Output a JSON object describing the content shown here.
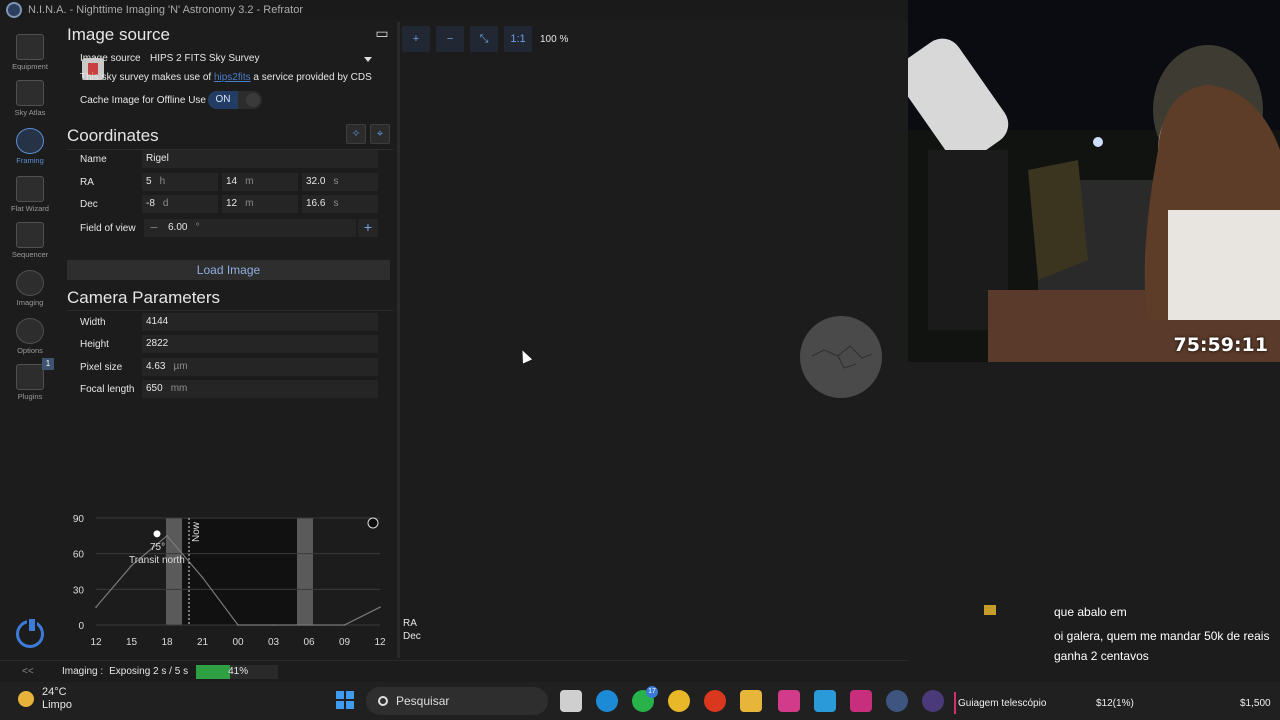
{
  "window": {
    "title": "N.I.N.A. - Nighttime Imaging 'N' Astronomy 3.2   -  Refrator"
  },
  "nav": {
    "items": [
      {
        "label": "Equipment"
      },
      {
        "label": "Sky Atlas"
      },
      {
        "label": "Framing"
      },
      {
        "label": "Flat Wizard"
      },
      {
        "label": "Sequencer"
      },
      {
        "label": "Imaging"
      },
      {
        "label": "Options"
      },
      {
        "label": "Plugins",
        "badge": "1"
      }
    ],
    "active": "Framing",
    "collapse": "<<"
  },
  "image_source": {
    "title": "Image source",
    "source_label": "Image source",
    "source_value": "HIPS 2 FITS Sky Survey",
    "note_prefix": "This sky survey makes use of ",
    "note_link": "hips2fits",
    "note_suffix": " a service provided by CDS",
    "cache_label": "Cache Image for Offline Use",
    "cache_toggle": "ON"
  },
  "coordinates": {
    "title": "Coordinates",
    "name_label": "Name",
    "name_value": "Rigel",
    "ra_label": "RA",
    "ra_h": "5",
    "ra_h_unit": "h",
    "ra_m": "14",
    "ra_m_unit": "m",
    "ra_s": "32.0",
    "ra_s_unit": "s",
    "dec_label": "Dec",
    "dec_d": "-8",
    "dec_d_unit": "d",
    "dec_m": "12",
    "dec_m_unit": "m",
    "dec_s": "16.6",
    "dec_s_unit": "s",
    "fov_label": "Field of view",
    "fov_value": "6.00",
    "fov_unit": "°",
    "load_button": "Load Image"
  },
  "camera": {
    "title": "Camera Parameters",
    "width_label": "Width",
    "width_value": "4144",
    "height_label": "Height",
    "height_value": "2822",
    "pixel_label": "Pixel size",
    "pixel_value": "4.63",
    "pixel_unit": "µm",
    "focal_label": "Focal length",
    "focal_value": "650",
    "focal_unit": "mm"
  },
  "altitude_chart": {
    "y_ticks": [
      "90",
      "60",
      "30",
      "0"
    ],
    "x_ticks": [
      "12",
      "15",
      "18",
      "21",
      "00",
      "03",
      "06",
      "09",
      "12"
    ],
    "now_label": "Now",
    "transit_degree": "75°",
    "transit_label": "Transit north"
  },
  "chart_data": {
    "type": "line",
    "x": [
      "12",
      "15",
      "18",
      "21",
      "00",
      "03",
      "06",
      "09",
      "12"
    ],
    "series": [
      {
        "values": [
          15,
          50,
          75,
          40,
          0,
          0,
          0,
          0,
          15
        ]
      }
    ],
    "ylim": [
      0,
      90
    ],
    "grid": true
  },
  "framing": {
    "zoom_in": "+",
    "zoom_out": "−",
    "fit": "⤡",
    "one_to_one": "1:1",
    "zoom_level": "100 %",
    "ra_label": "RA",
    "dec_label": "Dec"
  },
  "status": {
    "label": "Imaging :",
    "text": "Exposing 2 s / 5 s",
    "progress_percent": 41,
    "progress_text": "41%"
  },
  "webcam": {
    "timer": "75:59:11"
  },
  "chat": [
    {
      "name": "",
      "message": "que abalo em"
    },
    {
      "name": "",
      "message": "oi galera, quem me mandar 50k de reais ganha 2 centavos"
    }
  ],
  "taskbar": {
    "temp": "24°C",
    "weather": "Limpo",
    "search_placeholder": "Pesquisar",
    "whatsapp_badge": "17",
    "active_title": "Guiagem telescópio",
    "money1": "$12(1%)",
    "money2": "$1,500"
  },
  "colors": {
    "accent": "#3d7bd8",
    "progress": "#2ea043",
    "link": "#4b7dc9"
  }
}
